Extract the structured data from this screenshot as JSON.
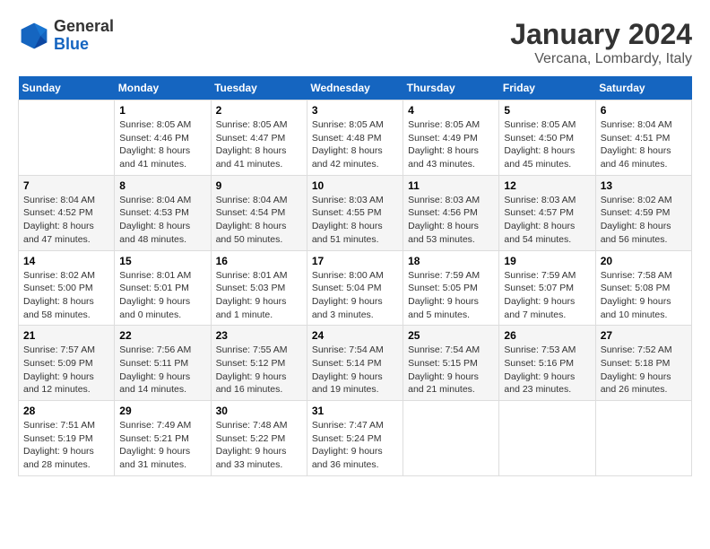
{
  "header": {
    "logo_general": "General",
    "logo_blue": "Blue",
    "month_title": "January 2024",
    "location": "Vercana, Lombardy, Italy"
  },
  "weekdays": [
    "Sunday",
    "Monday",
    "Tuesday",
    "Wednesday",
    "Thursday",
    "Friday",
    "Saturday"
  ],
  "weeks": [
    [
      {
        "day": "",
        "sunrise": "",
        "sunset": "",
        "daylight": ""
      },
      {
        "day": "1",
        "sunrise": "Sunrise: 8:05 AM",
        "sunset": "Sunset: 4:46 PM",
        "daylight": "Daylight: 8 hours and 41 minutes."
      },
      {
        "day": "2",
        "sunrise": "Sunrise: 8:05 AM",
        "sunset": "Sunset: 4:47 PM",
        "daylight": "Daylight: 8 hours and 41 minutes."
      },
      {
        "day": "3",
        "sunrise": "Sunrise: 8:05 AM",
        "sunset": "Sunset: 4:48 PM",
        "daylight": "Daylight: 8 hours and 42 minutes."
      },
      {
        "day": "4",
        "sunrise": "Sunrise: 8:05 AM",
        "sunset": "Sunset: 4:49 PM",
        "daylight": "Daylight: 8 hours and 43 minutes."
      },
      {
        "day": "5",
        "sunrise": "Sunrise: 8:05 AM",
        "sunset": "Sunset: 4:50 PM",
        "daylight": "Daylight: 8 hours and 45 minutes."
      },
      {
        "day": "6",
        "sunrise": "Sunrise: 8:04 AM",
        "sunset": "Sunset: 4:51 PM",
        "daylight": "Daylight: 8 hours and 46 minutes."
      }
    ],
    [
      {
        "day": "7",
        "sunrise": "Sunrise: 8:04 AM",
        "sunset": "Sunset: 4:52 PM",
        "daylight": "Daylight: 8 hours and 47 minutes."
      },
      {
        "day": "8",
        "sunrise": "Sunrise: 8:04 AM",
        "sunset": "Sunset: 4:53 PM",
        "daylight": "Daylight: 8 hours and 48 minutes."
      },
      {
        "day": "9",
        "sunrise": "Sunrise: 8:04 AM",
        "sunset": "Sunset: 4:54 PM",
        "daylight": "Daylight: 8 hours and 50 minutes."
      },
      {
        "day": "10",
        "sunrise": "Sunrise: 8:03 AM",
        "sunset": "Sunset: 4:55 PM",
        "daylight": "Daylight: 8 hours and 51 minutes."
      },
      {
        "day": "11",
        "sunrise": "Sunrise: 8:03 AM",
        "sunset": "Sunset: 4:56 PM",
        "daylight": "Daylight: 8 hours and 53 minutes."
      },
      {
        "day": "12",
        "sunrise": "Sunrise: 8:03 AM",
        "sunset": "Sunset: 4:57 PM",
        "daylight": "Daylight: 8 hours and 54 minutes."
      },
      {
        "day": "13",
        "sunrise": "Sunrise: 8:02 AM",
        "sunset": "Sunset: 4:59 PM",
        "daylight": "Daylight: 8 hours and 56 minutes."
      }
    ],
    [
      {
        "day": "14",
        "sunrise": "Sunrise: 8:02 AM",
        "sunset": "Sunset: 5:00 PM",
        "daylight": "Daylight: 8 hours and 58 minutes."
      },
      {
        "day": "15",
        "sunrise": "Sunrise: 8:01 AM",
        "sunset": "Sunset: 5:01 PM",
        "daylight": "Daylight: 9 hours and 0 minutes."
      },
      {
        "day": "16",
        "sunrise": "Sunrise: 8:01 AM",
        "sunset": "Sunset: 5:03 PM",
        "daylight": "Daylight: 9 hours and 1 minute."
      },
      {
        "day": "17",
        "sunrise": "Sunrise: 8:00 AM",
        "sunset": "Sunset: 5:04 PM",
        "daylight": "Daylight: 9 hours and 3 minutes."
      },
      {
        "day": "18",
        "sunrise": "Sunrise: 7:59 AM",
        "sunset": "Sunset: 5:05 PM",
        "daylight": "Daylight: 9 hours and 5 minutes."
      },
      {
        "day": "19",
        "sunrise": "Sunrise: 7:59 AM",
        "sunset": "Sunset: 5:07 PM",
        "daylight": "Daylight: 9 hours and 7 minutes."
      },
      {
        "day": "20",
        "sunrise": "Sunrise: 7:58 AM",
        "sunset": "Sunset: 5:08 PM",
        "daylight": "Daylight: 9 hours and 10 minutes."
      }
    ],
    [
      {
        "day": "21",
        "sunrise": "Sunrise: 7:57 AM",
        "sunset": "Sunset: 5:09 PM",
        "daylight": "Daylight: 9 hours and 12 minutes."
      },
      {
        "day": "22",
        "sunrise": "Sunrise: 7:56 AM",
        "sunset": "Sunset: 5:11 PM",
        "daylight": "Daylight: 9 hours and 14 minutes."
      },
      {
        "day": "23",
        "sunrise": "Sunrise: 7:55 AM",
        "sunset": "Sunset: 5:12 PM",
        "daylight": "Daylight: 9 hours and 16 minutes."
      },
      {
        "day": "24",
        "sunrise": "Sunrise: 7:54 AM",
        "sunset": "Sunset: 5:14 PM",
        "daylight": "Daylight: 9 hours and 19 minutes."
      },
      {
        "day": "25",
        "sunrise": "Sunrise: 7:54 AM",
        "sunset": "Sunset: 5:15 PM",
        "daylight": "Daylight: 9 hours and 21 minutes."
      },
      {
        "day": "26",
        "sunrise": "Sunrise: 7:53 AM",
        "sunset": "Sunset: 5:16 PM",
        "daylight": "Daylight: 9 hours and 23 minutes."
      },
      {
        "day": "27",
        "sunrise": "Sunrise: 7:52 AM",
        "sunset": "Sunset: 5:18 PM",
        "daylight": "Daylight: 9 hours and 26 minutes."
      }
    ],
    [
      {
        "day": "28",
        "sunrise": "Sunrise: 7:51 AM",
        "sunset": "Sunset: 5:19 PM",
        "daylight": "Daylight: 9 hours and 28 minutes."
      },
      {
        "day": "29",
        "sunrise": "Sunrise: 7:49 AM",
        "sunset": "Sunset: 5:21 PM",
        "daylight": "Daylight: 9 hours and 31 minutes."
      },
      {
        "day": "30",
        "sunrise": "Sunrise: 7:48 AM",
        "sunset": "Sunset: 5:22 PM",
        "daylight": "Daylight: 9 hours and 33 minutes."
      },
      {
        "day": "31",
        "sunrise": "Sunrise: 7:47 AM",
        "sunset": "Sunset: 5:24 PM",
        "daylight": "Daylight: 9 hours and 36 minutes."
      },
      {
        "day": "",
        "sunrise": "",
        "sunset": "",
        "daylight": ""
      },
      {
        "day": "",
        "sunrise": "",
        "sunset": "",
        "daylight": ""
      },
      {
        "day": "",
        "sunrise": "",
        "sunset": "",
        "daylight": ""
      }
    ]
  ]
}
